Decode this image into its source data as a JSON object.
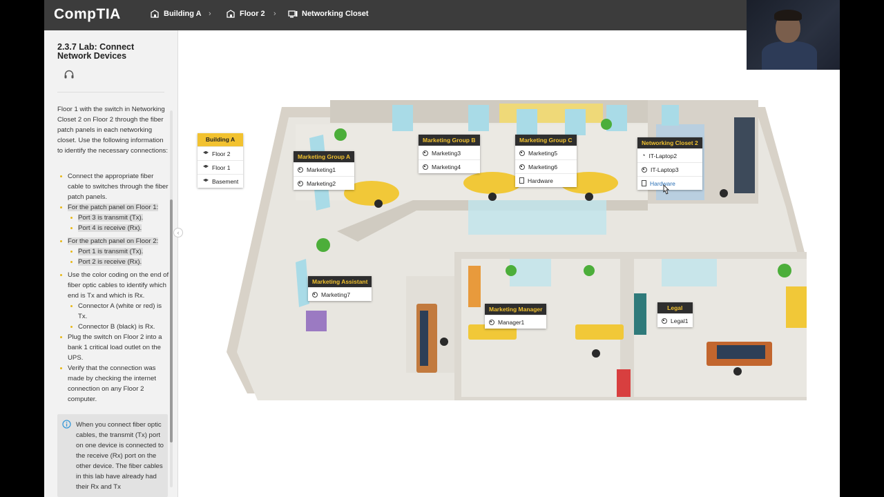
{
  "app": {
    "logo": "CompTIA"
  },
  "breadcrumb": [
    {
      "label": "Building A",
      "icon": "building-icon"
    },
    {
      "label": "Floor 2",
      "icon": "building-icon"
    },
    {
      "label": "Networking Closet",
      "icon": "computer-icon"
    }
  ],
  "sidebar": {
    "title": "2.3.7 Lab: Connect Network Devices",
    "intro": "Floor 1 with the switch in Networking Closet 2 on Floor 2 through the fiber patch panels in each networking closet. Use the following information to identify the necessary connections:",
    "steps": [
      "Connect the appropriate fiber cable to switches through the fiber patch panels.",
      "For the patch panel on Floor 1:",
      "Port 3 is transmit (Tx).",
      "Port 4 is receive (Rx).",
      "For the patch panel on Floor 2:",
      "Port 1 is transmit (Tx).",
      "Port 2 is receive (Rx).",
      "Use the color coding on the end of fiber optic cables to identify which end is Tx and which is Rx.",
      "Connector A (white or red) is Tx.",
      "Connector B (black) is Rx.",
      "Plug the switch on Floor 2 into a bank 1 critical load outlet on the UPS.",
      "Verify that the connection was made by checking the internet connection on any Floor 2 computer."
    ],
    "note": "When you connect fiber optic cables, the transmit (Tx) port on one device is connected to the receive (Rx) port on the other device. The fiber cables in this lab have already had their Rx and Tx"
  },
  "building_menu": {
    "title": "Building A",
    "items": [
      "Floor 2",
      "Floor 1",
      "Basement"
    ]
  },
  "rooms": {
    "mkt_a": {
      "title": "Marketing Group A",
      "items": [
        "Marketing1",
        "Marketing2"
      ]
    },
    "mkt_b": {
      "title": "Marketing Group B",
      "items": [
        "Marketing3",
        "Marketing4"
      ]
    },
    "mkt_c": {
      "title": "Marketing Group C",
      "items": [
        "Marketing5",
        "Marketing6",
        "Hardware"
      ]
    },
    "net2": {
      "title": "Networking Closet 2",
      "items": [
        "IT-Laptop2",
        "IT-Laptop3",
        "Hardware"
      ]
    },
    "assistant": {
      "title": "Marketing Assistant",
      "items": [
        "Marketing7"
      ]
    },
    "manager": {
      "title": "Marketing Manager",
      "items": [
        "Manager1"
      ]
    },
    "legal": {
      "title": "Legal",
      "items": [
        "Legal1"
      ]
    }
  },
  "colors": {
    "accent": "#f2c230",
    "topbar": "#3c3c3c",
    "sidebar": "#f2f2f2"
  }
}
